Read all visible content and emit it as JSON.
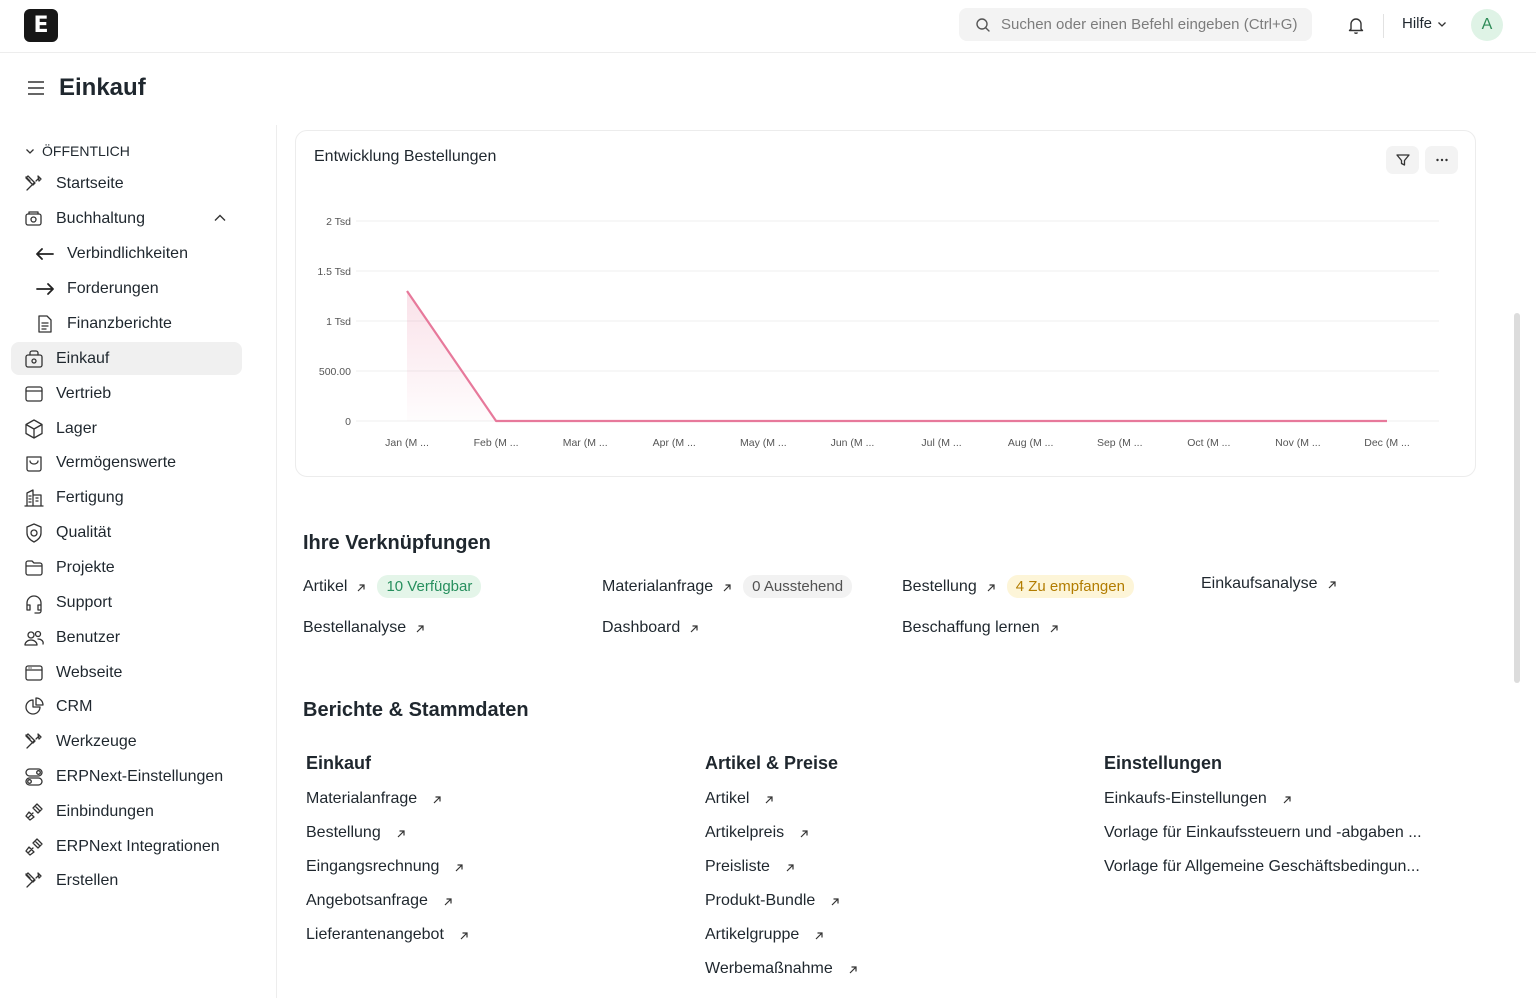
{
  "app": {
    "logo_letter": "E"
  },
  "navbar": {
    "search_placeholder": "Suchen oder einen Befehl eingeben (Ctrl+G)",
    "help_label": "Hilfe",
    "avatar_initial": "A"
  },
  "page": {
    "title": "Einkauf"
  },
  "sidebar": {
    "section_label": "ÖFFENTLICH",
    "items": [
      {
        "label": "Startseite",
        "icon": "tools-icon"
      },
      {
        "label": "Buchhaltung",
        "icon": "accounting-icon"
      },
      {
        "label": "Verbindlichkeiten",
        "icon": "arrow-left-icon"
      },
      {
        "label": "Forderungen",
        "icon": "arrow-right-icon"
      },
      {
        "label": "Finanzberichte",
        "icon": "document-icon"
      },
      {
        "label": "Einkauf",
        "icon": "purchase-icon"
      },
      {
        "label": "Vertrieb",
        "icon": "sales-icon"
      },
      {
        "label": "Lager",
        "icon": "box-icon"
      },
      {
        "label": "Vermögenswerte",
        "icon": "assets-icon"
      },
      {
        "label": "Fertigung",
        "icon": "building-icon"
      },
      {
        "label": "Qualität",
        "icon": "shield-icon"
      },
      {
        "label": "Projekte",
        "icon": "folder-icon"
      },
      {
        "label": "Support",
        "icon": "headset-icon"
      },
      {
        "label": "Benutzer",
        "icon": "users-icon"
      },
      {
        "label": "Webseite",
        "icon": "browser-icon"
      },
      {
        "label": "CRM",
        "icon": "pie-icon"
      },
      {
        "label": "Werkzeuge",
        "icon": "tools-icon"
      },
      {
        "label": "ERPNext-Einstellungen",
        "icon": "toggles-icon"
      },
      {
        "label": "Einbindungen",
        "icon": "plug-icon"
      },
      {
        "label": "ERPNext Integrationen",
        "icon": "plug-icon"
      },
      {
        "label": "Erstellen",
        "icon": "tools-icon"
      }
    ]
  },
  "chart_card": {
    "title": "Entwicklung Bestellungen",
    "accent_color": "#e7799b"
  },
  "chart_data": {
    "type": "line",
    "title": "Entwicklung Bestellungen",
    "categories": [
      "Jan (M ...",
      "Feb (M ...",
      "Mar (M ...",
      "Apr (M ...",
      "May (M ...",
      "Jun (M ...",
      "Jul (M ...",
      "Aug (M ...",
      "Sep (M ...",
      "Oct (M ...",
      "Nov (M ...",
      "Dec (M ..."
    ],
    "values": [
      1300,
      0,
      0,
      0,
      0,
      0,
      0,
      0,
      0,
      0,
      0,
      0
    ],
    "ylim": [
      0,
      2000
    ],
    "yticks": [
      0,
      500,
      1000,
      1500,
      2000
    ],
    "ytick_labels": [
      "0",
      "500.00",
      "1 Tsd",
      "1.5 Tsd",
      "2 Tsd"
    ],
    "grid": true,
    "color": "#e7799b"
  },
  "shortcuts": {
    "heading": "Ihre Verknüpfungen",
    "items": [
      {
        "label": "Artikel",
        "badge": "10 Verfügbar",
        "badge_color": "green"
      },
      {
        "label": "Materialanfrage",
        "badge": "0 Ausstehend",
        "badge_color": "gray"
      },
      {
        "label": "Bestellung",
        "badge": "4 Zu empfangen",
        "badge_color": "yellow"
      },
      {
        "label": "Einkaufsanalyse"
      },
      {
        "label": "Bestellanalyse"
      },
      {
        "label": "Dashboard"
      },
      {
        "label": "Beschaffung lernen"
      }
    ]
  },
  "reports": {
    "heading": "Berichte & Stammdaten",
    "columns": [
      {
        "title": "Einkauf",
        "links": [
          "Materialanfrage",
          "Bestellung",
          "Eingangsrechnung",
          "Angebotsanfrage",
          "Lieferantenangebot"
        ]
      },
      {
        "title": "Artikel & Preise",
        "links": [
          "Artikel",
          "Artikelpreis",
          "Preisliste",
          "Produkt-Bundle",
          "Artikelgruppe",
          "Werbemaßnahme"
        ]
      },
      {
        "title": "Einstellungen",
        "links": [
          "Einkaufs-Einstellungen",
          "Vorlage für Einkaufssteuern und -abgaben ...",
          "Vorlage für Allgemeine Geschäftsbedingun..."
        ]
      }
    ]
  }
}
